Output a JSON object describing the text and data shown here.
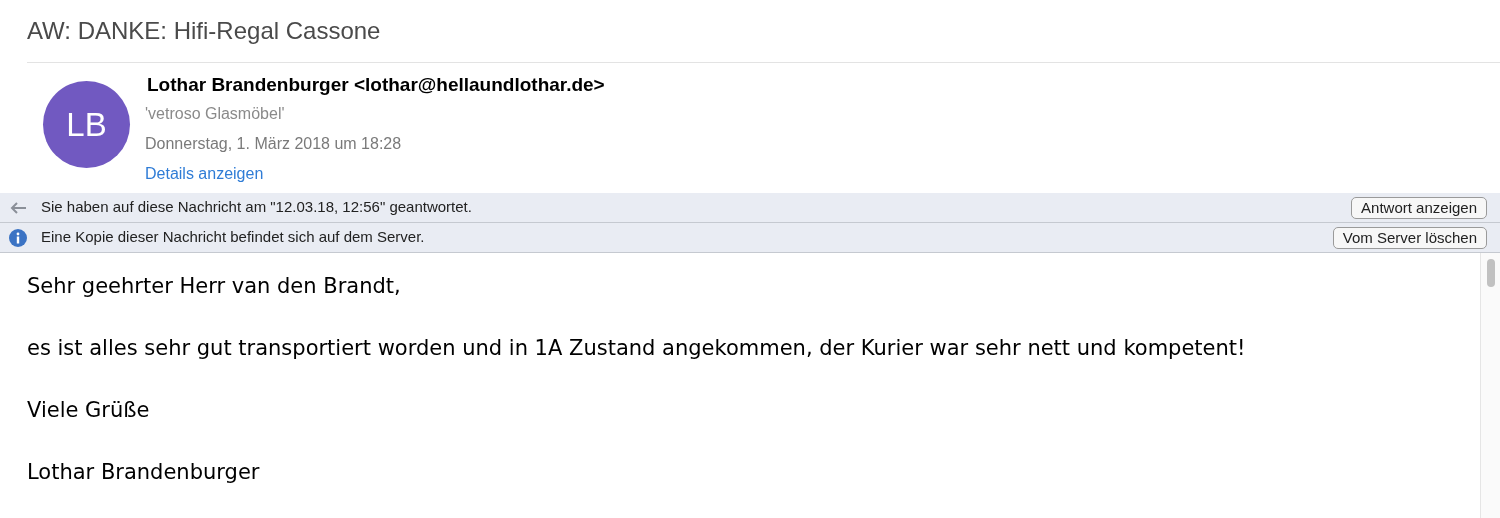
{
  "subject": "AW: DANKE: Hifi-Regal Cassone",
  "header": {
    "avatar_initials": "LB",
    "sender": "Lothar Brandenburger <lothar@hellaundlothar.de>",
    "recipient": "'vetroso Glasmöbel'",
    "date": "Donnerstag, 1. März 2018 um 18:28",
    "details_link": "Details anzeigen"
  },
  "notifications": [
    {
      "kind": "replied",
      "text": "Sie haben auf diese Nachricht am \"12.03.18, 12:56\" geantwortet.",
      "button": "Antwort anzeigen"
    },
    {
      "kind": "info",
      "text": "Eine Kopie dieser Nachricht befindet sich auf dem Server.",
      "button": "Vom Server löschen"
    }
  ],
  "body": [
    "Sehr geehrter Herr van den Brandt,",
    "es ist alles sehr gut transportiert worden und in 1A Zustand angekommen, der Kurier war sehr nett und kompetent!",
    "Viele Grüße",
    "Lothar Brandenburger"
  ]
}
